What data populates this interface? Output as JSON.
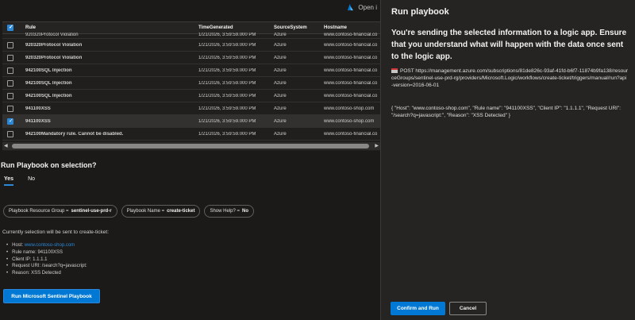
{
  "header": {
    "open_label": "Open i",
    "azure_icon": "azure-icon"
  },
  "table": {
    "columns": [
      "Rule",
      "TimeGenerated",
      "SourceSystem",
      "Hostname"
    ],
    "partial_row": {
      "rule": "920320Protocol Violation",
      "time": "1/21/2026, 3:59:59.000 PM",
      "source": "Azure",
      "host": "www.contoso-financial.co"
    },
    "rows": [
      {
        "rule": "920320Protocol Violation",
        "time": "1/21/2026, 3:59:59.000 PM",
        "source": "Azure",
        "host": "www.contoso-financial.co",
        "checked": false
      },
      {
        "rule": "920320Protocol Violation",
        "time": "1/21/2026, 3:59:59.000 PM",
        "source": "Azure",
        "host": "www.contoso-financial.co",
        "checked": false
      },
      {
        "rule": "942100SQL Injection",
        "time": "1/21/2026, 3:59:59.000 PM",
        "source": "Azure",
        "host": "www.contoso-financial.co",
        "checked": false
      },
      {
        "rule": "942100SQL Injection",
        "time": "1/21/2026, 3:59:59.000 PM",
        "source": "Azure",
        "host": "www.contoso-financial.co",
        "checked": false
      },
      {
        "rule": "942100SQL Injection",
        "time": "1/21/2026, 3:59:59.000 PM",
        "source": "Azure",
        "host": "www.contoso-financial.co",
        "checked": false
      },
      {
        "rule": "941100XSS",
        "time": "1/21/2026, 3:59:59.000 PM",
        "source": "Azure",
        "host": "www.contoso-shop.com",
        "checked": false
      },
      {
        "rule": "941100XSS",
        "time": "1/21/2026, 3:59:59.000 PM",
        "source": "Azure",
        "host": "www.contoso-shop.com",
        "checked": true
      },
      {
        "rule": "942100Mandatory rule. Cannot be disabled.",
        "time": "1/21/2026, 3:59:59.000 PM",
        "source": "Azure",
        "host": "www.contoso-financial.co",
        "checked": false
      }
    ]
  },
  "run_section": {
    "title": "Run Playbook on selection?",
    "tabs": [
      {
        "label": "Yes",
        "active": true
      },
      {
        "label": "No",
        "active": false
      }
    ],
    "params": [
      {
        "key": "Playbook Resource Group =",
        "value": "sentinel-use-prd-r"
      },
      {
        "key": "Playbook Name =",
        "value": "create-ticket"
      },
      {
        "key": "Show Help? =",
        "value": "No"
      }
    ],
    "description": "Currently selection will be sent to create-ticket:",
    "details": {
      "host_label": "Host:",
      "host_value": "www.contoso-shop.com",
      "rule_name": "Rule name: 941100XSS",
      "client_ip": "Client IP: 1.1.1.1",
      "request_uri": "Request URI: /search?q=javascript:",
      "reason": "Reason: XSS Detected"
    },
    "run_button": "Run Microsoft Sentinel Playbook"
  },
  "panel": {
    "title": "Run playbook",
    "warning": "You're sending the selected information to a logic app. Ensure that you understand what will happen with the data once sent to the logic app.",
    "request": "POST https://management.azure.com/subscriptions/81de826c-93af-41fd-b6f7-11874b9fa138/resourceGroups/sentinel-use-prd-rg/providers/Microsoft.Logic/workflows/create-ticket/triggers/manual/run?api-version=2016-06-01",
    "payload": "{ \"Host\": \"www.contoso-shop.com\", \"Rule name\": \"941100XSS\", \"Client IP\": \"1.1.1.1\", \"Request URI\": \"/search?q=javascript:\", \"Reason\": \"XSS Detected\" }",
    "confirm_button": "Confirm and Run",
    "cancel_button": "Cancel"
  },
  "colors": {
    "accent": "#0078d4",
    "link": "#2b88d8",
    "background": "#1b1a19",
    "panel": "#252423"
  }
}
